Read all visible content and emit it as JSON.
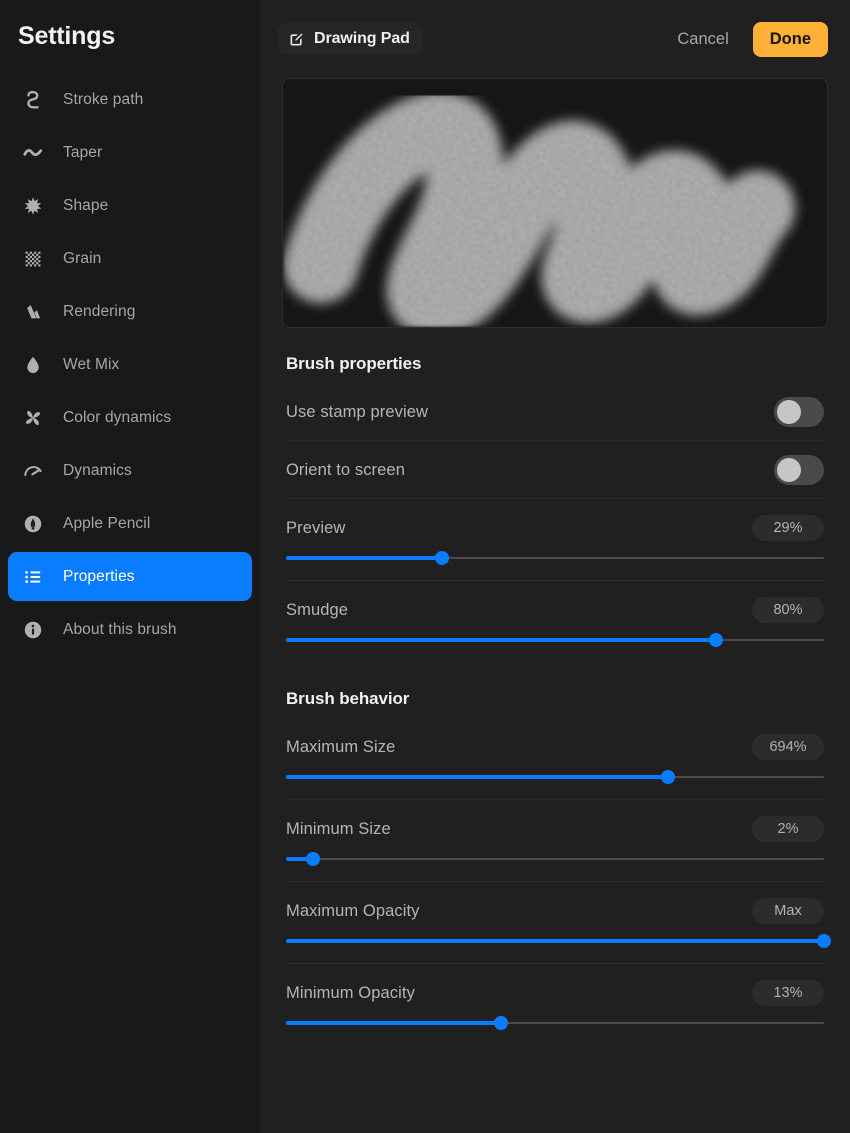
{
  "sidebar": {
    "title": "Settings",
    "items": [
      {
        "label": "Stroke path",
        "icon": "stroke-path-icon",
        "selected": false
      },
      {
        "label": "Taper",
        "icon": "taper-wave-icon",
        "selected": false
      },
      {
        "label": "Shape",
        "icon": "shape-starburst-icon",
        "selected": false
      },
      {
        "label": "Grain",
        "icon": "grain-checker-icon",
        "selected": false
      },
      {
        "label": "Rendering",
        "icon": "rendering-icon",
        "selected": false
      },
      {
        "label": "Wet Mix",
        "icon": "droplet-icon",
        "selected": false
      },
      {
        "label": "Color dynamics",
        "icon": "pinwheel-icon",
        "selected": false
      },
      {
        "label": "Dynamics",
        "icon": "speedometer-icon",
        "selected": false
      },
      {
        "label": "Apple Pencil",
        "icon": "apple-pencil-icon",
        "selected": false
      },
      {
        "label": "Properties",
        "icon": "list-icon",
        "selected": true
      },
      {
        "label": "About this brush",
        "icon": "info-icon",
        "selected": false
      }
    ]
  },
  "header": {
    "brush_name": "Drawing Pad",
    "brush_name_icon": "compose-edit-icon",
    "cancel_label": "Cancel",
    "done_label": "Done"
  },
  "preview": {
    "name": "brush-stroke-preview"
  },
  "sections": [
    {
      "title": "Brush properties",
      "rows": [
        {
          "type": "toggle",
          "label": "Use stamp preview",
          "on": false
        },
        {
          "type": "toggle",
          "label": "Orient to screen",
          "on": false
        },
        {
          "type": "slider",
          "label": "Preview",
          "value": "29%",
          "percent": 29
        },
        {
          "type": "slider",
          "label": "Smudge",
          "value": "80%",
          "percent": 80
        }
      ]
    },
    {
      "title": "Brush behavior",
      "rows": [
        {
          "type": "slider",
          "label": "Maximum Size",
          "value": "694%",
          "percent": 71
        },
        {
          "type": "slider",
          "label": "Minimum Size",
          "value": "2%",
          "percent": 5
        },
        {
          "type": "slider",
          "label": "Maximum Opacity",
          "value": "Max",
          "percent": 100
        },
        {
          "type": "slider",
          "label": "Minimum Opacity",
          "value": "13%",
          "percent": 40
        }
      ]
    }
  ],
  "colors": {
    "accent_blue": "#0a7cff",
    "done_orange": "#fdb137",
    "sidebar_bg": "#191919",
    "panel_bg": "#202020",
    "canvas_bg": "#161616"
  }
}
